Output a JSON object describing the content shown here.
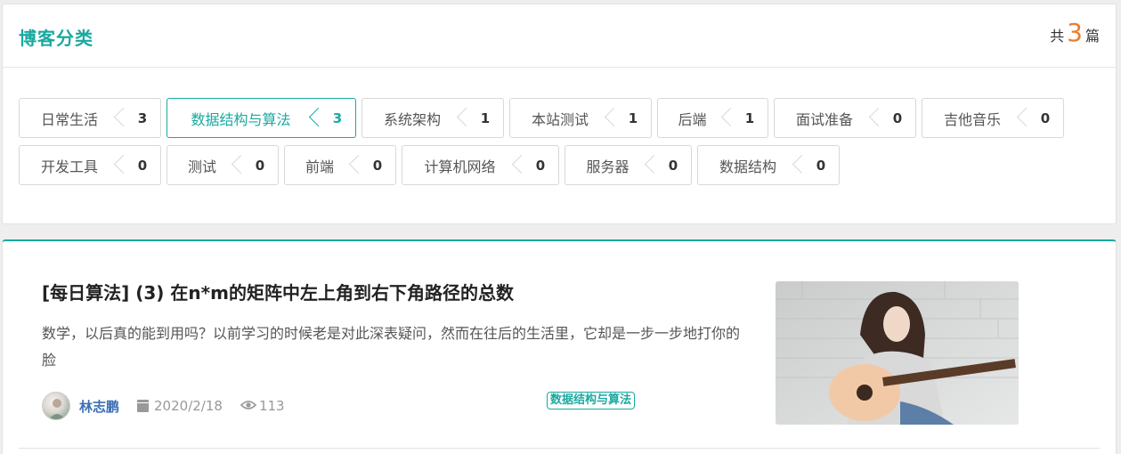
{
  "categories": {
    "title": "博客分类",
    "total_prefix": "共",
    "total_count": "3",
    "total_suffix": "篇",
    "items": [
      {
        "name": "日常生活",
        "count": "3"
      },
      {
        "name": "数据结构与算法",
        "count": "3",
        "active": true
      },
      {
        "name": "系统架构",
        "count": "1"
      },
      {
        "name": "本站测试",
        "count": "1"
      },
      {
        "name": "后端",
        "count": "1"
      },
      {
        "name": "面试准备",
        "count": "0"
      },
      {
        "name": "吉他音乐",
        "count": "0"
      },
      {
        "name": "开发工具",
        "count": "0"
      },
      {
        "name": "测试",
        "count": "0"
      },
      {
        "name": "前端",
        "count": "0"
      },
      {
        "name": "计算机网络",
        "count": "0"
      },
      {
        "name": "服务器",
        "count": "0"
      },
      {
        "name": "数据结构",
        "count": "0"
      }
    ]
  },
  "article": {
    "title": "[每日算法] (3) 在n*m的矩阵中左上角到右下角路径的总数",
    "summary": "数学，以后真的能到用吗？以前学习的时候老是对此深表疑问，然而在往后的生活里，它却是一步一步地打你的脸",
    "author": "林志鹏",
    "date": "2020/2/18",
    "views": "113",
    "tag": "数据结构与算法",
    "thumbnail_icon": "guitar-girl-photo"
  },
  "colors": {
    "accent": "#1aa9a0",
    "count_highlight": "#f07a2c",
    "author_link": "#3d6fb5"
  }
}
